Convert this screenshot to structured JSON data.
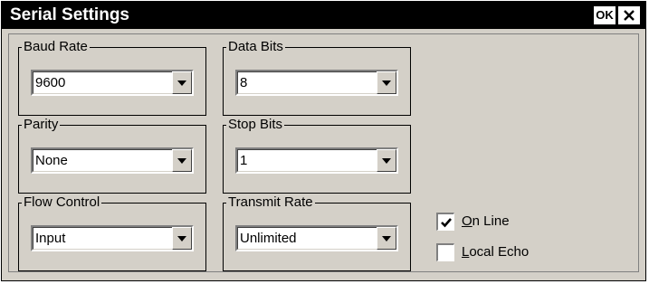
{
  "window": {
    "title": "Serial Settings",
    "ok_label": "OK",
    "close_icon": "close-icon"
  },
  "groups": {
    "baud_rate": {
      "label": "Baud Rate",
      "value": "9600"
    },
    "data_bits": {
      "label": "Data Bits",
      "value": "8"
    },
    "parity": {
      "label": "Parity",
      "value": "None"
    },
    "stop_bits": {
      "label": "Stop Bits",
      "value": "1"
    },
    "flow_control": {
      "label": "Flow Control",
      "value": "Input"
    },
    "transmit_rate": {
      "label": "Transmit Rate",
      "value": "Unlimited"
    }
  },
  "checkboxes": {
    "on_line": {
      "mnemonic": "O",
      "rest": "n Line",
      "checked": true
    },
    "local_echo": {
      "mnemonic": "L",
      "rest": "ocal Echo",
      "checked": false
    }
  },
  "colors": {
    "titlebar": "#000000",
    "face": "#d4d0c8",
    "field": "#ffffff"
  }
}
